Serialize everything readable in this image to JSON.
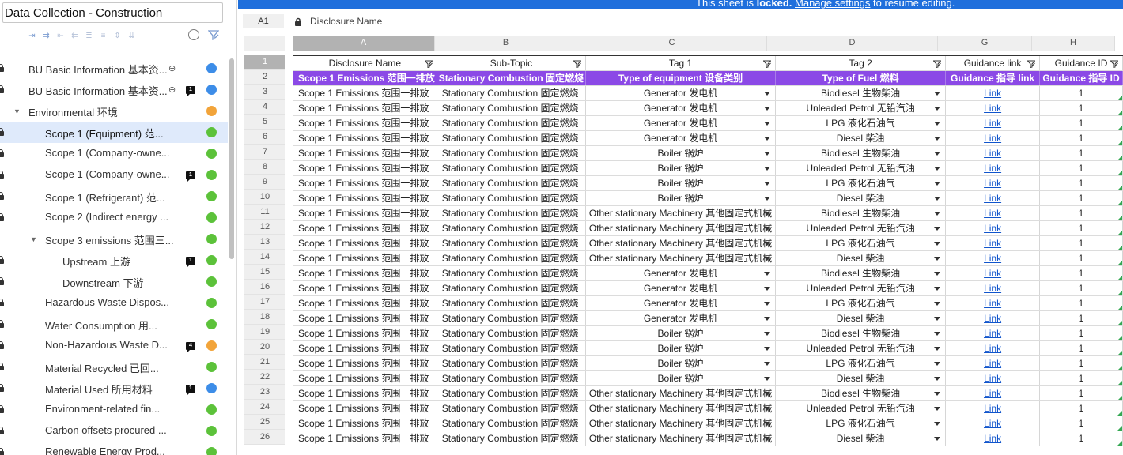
{
  "sidebar": {
    "title": "Data Collection - Construction",
    "toolbar_icons": [
      "indent-right-icon",
      "indent-more-icon",
      "outdent-icon",
      "indent-left-icon",
      "indent-less-icon",
      "collapse-icon",
      "move-up-down-icon",
      "expand-all-icon"
    ],
    "items": [
      {
        "label": "BU Basic Information 基本资...",
        "level": 0,
        "lock": true,
        "unlink": true,
        "badge": "",
        "status": "blue"
      },
      {
        "label": "BU Basic Information 基本资...",
        "level": 0,
        "lock": true,
        "unlink": true,
        "badge": "1",
        "status": "blue"
      },
      {
        "label": "Environmental 环境",
        "level": 0,
        "lock": false,
        "caret": true,
        "badge": "",
        "status": "orange"
      },
      {
        "label": "Scope 1 (Equipment) 范...",
        "level": 1,
        "lock": true,
        "badge": "",
        "status": "green",
        "selected": true
      },
      {
        "label": "Scope 1 (Company-owne...",
        "level": 1,
        "lock": true,
        "badge": "",
        "status": "green"
      },
      {
        "label": "Scope 1 (Company-owne...",
        "level": 1,
        "lock": true,
        "badge": "1",
        "status": "green"
      },
      {
        "label": "Scope 1 (Refrigerant) 范...",
        "level": 1,
        "lock": true,
        "badge": "",
        "status": "green"
      },
      {
        "label": "Scope 2 (Indirect energy ...",
        "level": 1,
        "lock": true,
        "badge": "",
        "status": "green"
      },
      {
        "label": "Scope 3 emissions 范围三...",
        "level": 1,
        "lock": false,
        "caret": true,
        "badge": "",
        "status": "green"
      },
      {
        "label": "Upstream 上游",
        "level": 2,
        "lock": true,
        "badge": "1",
        "status": "green"
      },
      {
        "label": "Downstream 下游",
        "level": 2,
        "lock": true,
        "badge": "",
        "status": "green"
      },
      {
        "label": "Hazardous Waste Dispos...",
        "level": 1,
        "lock": true,
        "badge": "",
        "status": "green"
      },
      {
        "label": "Water Consumption 用...",
        "level": 1,
        "lock": true,
        "badge": "",
        "status": "green"
      },
      {
        "label": "Non-Hazardous Waste D...",
        "level": 1,
        "lock": true,
        "badge": "4",
        "status": "orange"
      },
      {
        "label": "Material Recycled 已回...",
        "level": 1,
        "lock": true,
        "badge": "",
        "status": "green"
      },
      {
        "label": "Material Used 所用材料",
        "level": 1,
        "lock": true,
        "badge": "1",
        "status": "blue"
      },
      {
        "label": "Environment-related fin...",
        "level": 1,
        "lock": true,
        "badge": "",
        "status": "green"
      },
      {
        "label": "Carbon offsets procured ...",
        "level": 1,
        "lock": true,
        "badge": "",
        "status": "green"
      },
      {
        "label": "Renewable Energy Prod...",
        "level": 1,
        "lock": true,
        "badge": "",
        "status": "green"
      }
    ]
  },
  "colors": {
    "blue": "#3d8de8",
    "green": "#5cc23a",
    "orange": "#f2a43a",
    "purple": "#8b49e6",
    "banner": "#1f6fdc"
  },
  "banner": {
    "prefix": "This sheet is ",
    "bold": "locked.",
    "link": "Manage settings",
    "suffix": " to resume editing."
  },
  "formula_bar": {
    "cell_ref": "A1",
    "value": "Disclosure Name"
  },
  "sheet": {
    "columns": [
      "A",
      "B",
      "C",
      "D",
      "G",
      "H"
    ],
    "row_numbers": [
      "1",
      "2",
      "3",
      "4",
      "5",
      "6",
      "7",
      "8",
      "9",
      "10",
      "11",
      "12",
      "13",
      "14",
      "15",
      "16",
      "17",
      "18",
      "19",
      "20",
      "21",
      "22",
      "23",
      "24",
      "25",
      "26"
    ],
    "headers": [
      "Disclosure Name",
      "Sub-Topic",
      "Tag 1",
      "Tag 2",
      "Guidance link",
      "Guidance ID"
    ],
    "subheaders": [
      "Scope 1 Emissions 范围一排放",
      "Stationary Combustion 固定燃烧",
      "Type of equipment 设备类别",
      "Type of Fuel 燃料",
      "Guidance 指导 link",
      "Guidance 指导 ID"
    ],
    "rows": [
      [
        "Scope 1 Emissions 范围一排放",
        "Stationary Combustion 固定燃烧",
        "Generator 发电机",
        "Biodiesel 生物柴油",
        "Link",
        "1"
      ],
      [
        "Scope 1 Emissions 范围一排放",
        "Stationary Combustion 固定燃烧",
        "Generator 发电机",
        "Unleaded Petrol 无铅汽油",
        "Link",
        "1"
      ],
      [
        "Scope 1 Emissions 范围一排放",
        "Stationary Combustion 固定燃烧",
        "Generator 发电机",
        "LPG 液化石油气",
        "Link",
        "1"
      ],
      [
        "Scope 1 Emissions 范围一排放",
        "Stationary Combustion 固定燃烧",
        "Generator 发电机",
        "Diesel 柴油",
        "Link",
        "1"
      ],
      [
        "Scope 1 Emissions 范围一排放",
        "Stationary Combustion 固定燃烧",
        "Boiler 锅炉",
        "Biodiesel 生物柴油",
        "Link",
        "1"
      ],
      [
        "Scope 1 Emissions 范围一排放",
        "Stationary Combustion 固定燃烧",
        "Boiler 锅炉",
        "Unleaded Petrol 无铅汽油",
        "Link",
        "1"
      ],
      [
        "Scope 1 Emissions 范围一排放",
        "Stationary Combustion 固定燃烧",
        "Boiler 锅炉",
        "LPG 液化石油气",
        "Link",
        "1"
      ],
      [
        "Scope 1 Emissions 范围一排放",
        "Stationary Combustion 固定燃烧",
        "Boiler 锅炉",
        "Diesel 柴油",
        "Link",
        "1"
      ],
      [
        "Scope 1 Emissions 范围一排放",
        "Stationary Combustion 固定燃烧",
        "Other stationary Machinery 其他固定式机械",
        "Biodiesel 生物柴油",
        "Link",
        "1"
      ],
      [
        "Scope 1 Emissions 范围一排放",
        "Stationary Combustion 固定燃烧",
        "Other stationary Machinery 其他固定式机械",
        "Unleaded Petrol 无铅汽油",
        "Link",
        "1"
      ],
      [
        "Scope 1 Emissions 范围一排放",
        "Stationary Combustion 固定燃烧",
        "Other stationary Machinery 其他固定式机械",
        "LPG 液化石油气",
        "Link",
        "1"
      ],
      [
        "Scope 1 Emissions 范围一排放",
        "Stationary Combustion 固定燃烧",
        "Other stationary Machinery 其他固定式机械",
        "Diesel 柴油",
        "Link",
        "1"
      ],
      [
        "Scope 1 Emissions 范围一排放",
        "Stationary Combustion 固定燃烧",
        "Generator 发电机",
        "Biodiesel 生物柴油",
        "Link",
        "1"
      ],
      [
        "Scope 1 Emissions 范围一排放",
        "Stationary Combustion 固定燃烧",
        "Generator 发电机",
        "Unleaded Petrol 无铅汽油",
        "Link",
        "1"
      ],
      [
        "Scope 1 Emissions 范围一排放",
        "Stationary Combustion 固定燃烧",
        "Generator 发电机",
        "LPG 液化石油气",
        "Link",
        "1"
      ],
      [
        "Scope 1 Emissions 范围一排放",
        "Stationary Combustion 固定燃烧",
        "Generator 发电机",
        "Diesel 柴油",
        "Link",
        "1"
      ],
      [
        "Scope 1 Emissions 范围一排放",
        "Stationary Combustion 固定燃烧",
        "Boiler 锅炉",
        "Biodiesel 生物柴油",
        "Link",
        "1"
      ],
      [
        "Scope 1 Emissions 范围一排放",
        "Stationary Combustion 固定燃烧",
        "Boiler 锅炉",
        "Unleaded Petrol 无铅汽油",
        "Link",
        "1"
      ],
      [
        "Scope 1 Emissions 范围一排放",
        "Stationary Combustion 固定燃烧",
        "Boiler 锅炉",
        "LPG 液化石油气",
        "Link",
        "1"
      ],
      [
        "Scope 1 Emissions 范围一排放",
        "Stationary Combustion 固定燃烧",
        "Boiler 锅炉",
        "Diesel 柴油",
        "Link",
        "1"
      ],
      [
        "Scope 1 Emissions 范围一排放",
        "Stationary Combustion 固定燃烧",
        "Other stationary Machinery 其他固定式机械",
        "Biodiesel 生物柴油",
        "Link",
        "1"
      ],
      [
        "Scope 1 Emissions 范围一排放",
        "Stationary Combustion 固定燃烧",
        "Other stationary Machinery 其他固定式机械",
        "Unleaded Petrol 无铅汽油",
        "Link",
        "1"
      ],
      [
        "Scope 1 Emissions 范围一排放",
        "Stationary Combustion 固定燃烧",
        "Other stationary Machinery 其他固定式机械",
        "LPG 液化石油气",
        "Link",
        "1"
      ],
      [
        "Scope 1 Emissions 范围一排放",
        "Stationary Combustion 固定燃烧",
        "Other stationary Machinery 其他固定式机械",
        "Diesel 柴油",
        "Link",
        "1"
      ]
    ]
  }
}
